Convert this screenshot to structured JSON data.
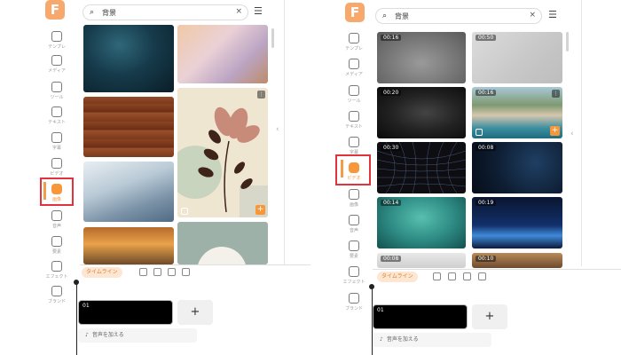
{
  "brand": {
    "logo_letter": "F"
  },
  "left_panel": {
    "rail": [
      {
        "label": "テンプレ",
        "icon": "template-icon"
      },
      {
        "label": "メディア",
        "icon": "media-folder-icon"
      },
      {
        "label": "ツール",
        "icon": "ai-tools-icon"
      },
      {
        "label": "テキスト",
        "icon": "text-icon"
      },
      {
        "label": "字幕",
        "icon": "subtitle-icon"
      },
      {
        "label": "ビデオ",
        "icon": "video-icon"
      },
      {
        "label": "画像",
        "icon": "image-icon",
        "active": true
      },
      {
        "label": "音声",
        "icon": "music-icon"
      },
      {
        "label": "要素",
        "icon": "shapes-icon"
      },
      {
        "label": "エフェクト",
        "icon": "effects-icon"
      },
      {
        "label": "ブランド",
        "icon": "brand-kit-icon"
      }
    ],
    "search": {
      "value": "背景",
      "clear": "×"
    },
    "timeline": {
      "tab_label": "タイムライン",
      "clip_label": "01",
      "add_clip": "+",
      "add_audio": "音声を加える"
    }
  },
  "right_panel": {
    "rail": [
      {
        "label": "テンプレ",
        "icon": "template-icon"
      },
      {
        "label": "メディア",
        "icon": "media-folder-icon"
      },
      {
        "label": "ツール",
        "icon": "ai-tools-icon"
      },
      {
        "label": "テキスト",
        "icon": "text-icon"
      },
      {
        "label": "字幕",
        "icon": "subtitle-icon"
      },
      {
        "label": "ビデオ",
        "icon": "video-icon",
        "active": true
      },
      {
        "label": "画像",
        "icon": "image-icon"
      },
      {
        "label": "音声",
        "icon": "music-icon"
      },
      {
        "label": "要素",
        "icon": "shapes-icon"
      },
      {
        "label": "エフェクト",
        "icon": "effects-icon"
      },
      {
        "label": "ブランド",
        "icon": "brand-kit-icon"
      }
    ],
    "search": {
      "value": "背景",
      "clear": "×"
    },
    "video_durations": [
      "00:16",
      "00:50",
      "00:20",
      "00:16",
      "00:30",
      "00:08",
      "00:14",
      "00:19",
      "00:08",
      "00:10"
    ],
    "timeline": {
      "tab_label": "タイムライン",
      "clip_label": "01",
      "add_clip": "+",
      "add_audio": "音声を加える"
    }
  },
  "colors": {
    "accent": "#f7973a",
    "highlight": "#e0333c"
  }
}
